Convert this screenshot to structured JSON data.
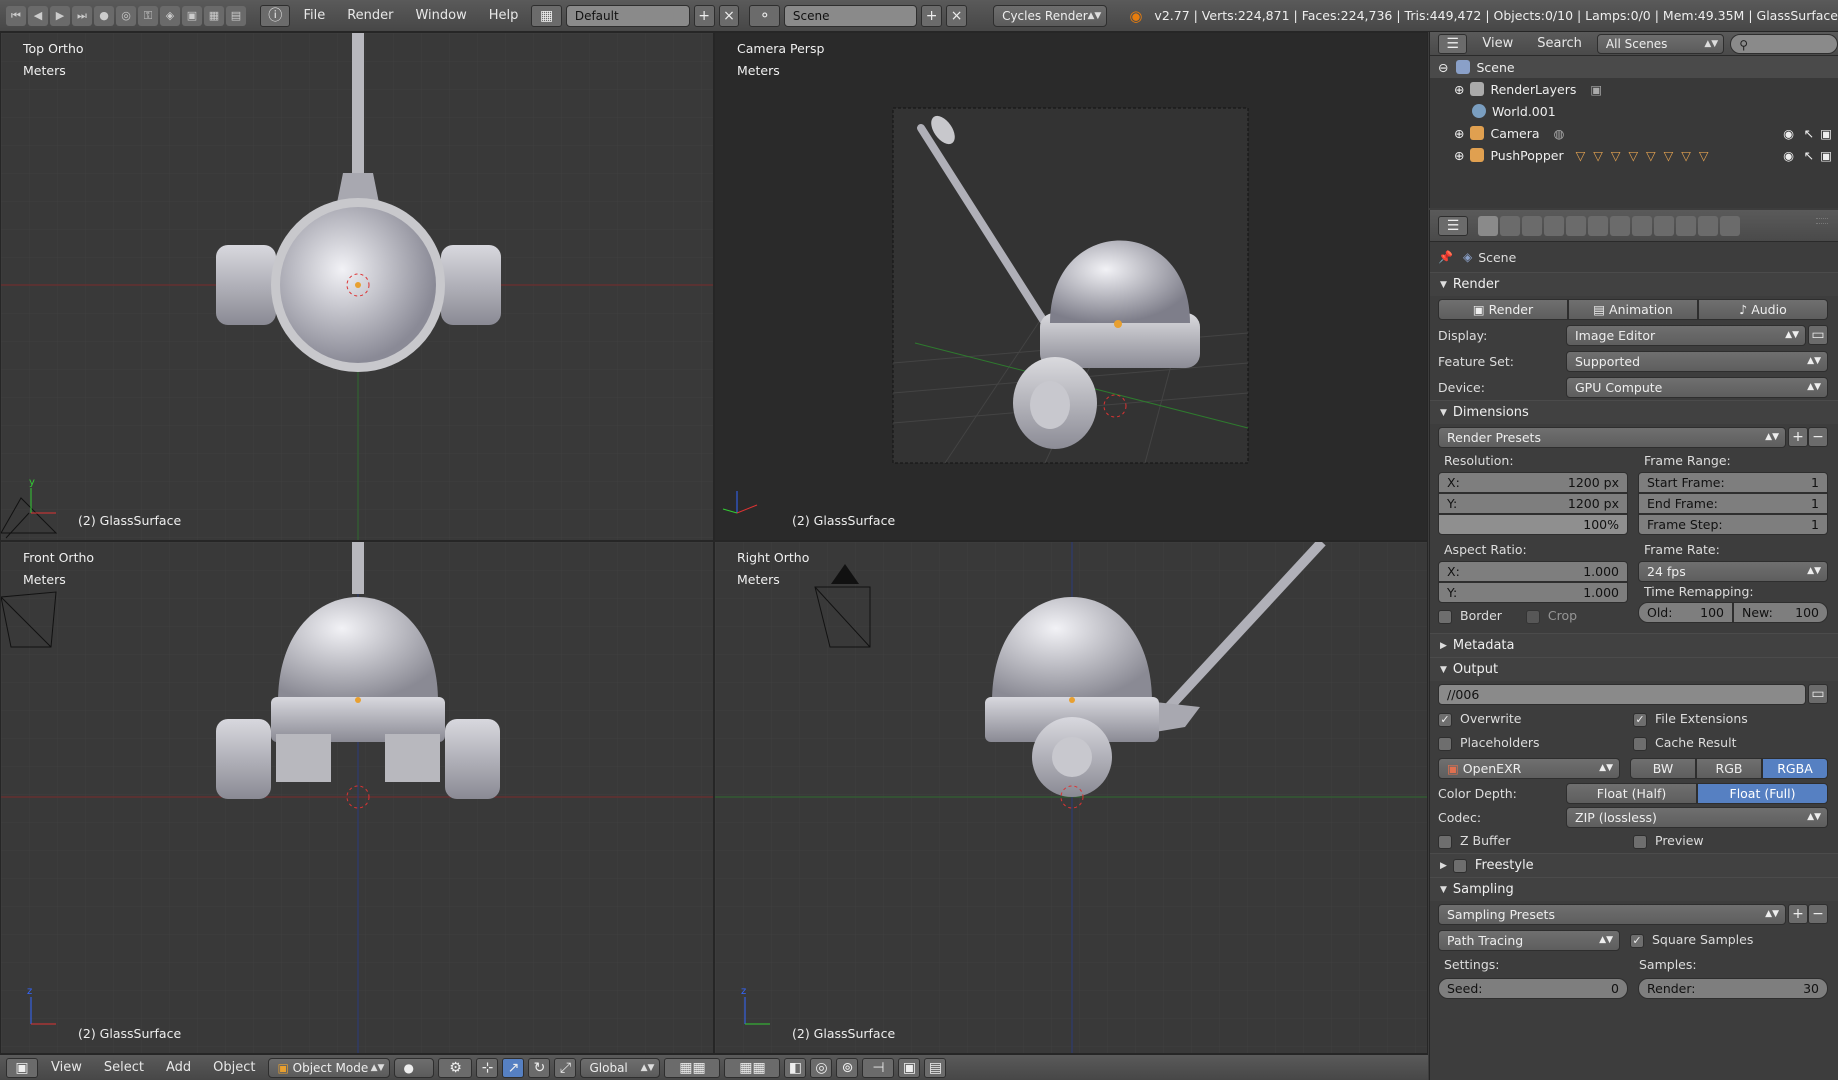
{
  "topbar": {
    "menus": [
      "File",
      "Render",
      "Window",
      "Help"
    ],
    "layout": "Default",
    "scene": "Scene",
    "engine": "Cycles Render",
    "stats": "v2.77 | Verts:224,871 | Faces:224,736 | Tris:449,472 | Objects:0/10 | Lamps:0/0 | Mem:49.35M | GlassSurface"
  },
  "viewports": {
    "top_left": {
      "view": "Top Ortho",
      "units": "Meters",
      "object": "(2) GlassSurface"
    },
    "top_right": {
      "view": "Camera Persp",
      "units": "Meters",
      "object": "(2) GlassSurface"
    },
    "bottom_left": {
      "view": "Front Ortho",
      "units": "Meters",
      "object": "(2) GlassSurface"
    },
    "bottom_right": {
      "view": "Right Ortho",
      "units": "Meters",
      "object": "(2) GlassSurface"
    }
  },
  "bottombar": {
    "menus": [
      "View",
      "Select",
      "Add",
      "Object"
    ],
    "mode": "Object Mode",
    "orientation": "Global"
  },
  "outliner": {
    "menus": [
      "View",
      "Search"
    ],
    "filter": "All Scenes",
    "items": [
      {
        "label": "Scene",
        "icon_color": "#8aa0c8",
        "indent": 0
      },
      {
        "label": "RenderLayers",
        "icon_color": "#aaaaaa",
        "indent": 1
      },
      {
        "label": "World.001",
        "icon_color": "#7a9ec0",
        "indent": 1
      },
      {
        "label": "Camera",
        "icon_color": "#e0a050",
        "indent": 1
      },
      {
        "label": "PushPopper",
        "icon_color": "#e0a050",
        "indent": 1
      }
    ]
  },
  "props": {
    "context": "Scene",
    "render": {
      "title": "Render",
      "buttons": [
        "Render",
        "Animation",
        "Audio"
      ],
      "display_label": "Display:",
      "display": "Image Editor",
      "featureset_label": "Feature Set:",
      "featureset": "Supported",
      "device_label": "Device:",
      "device": "GPU Compute"
    },
    "dimensions": {
      "title": "Dimensions",
      "presets": "Render Presets",
      "resolution_label": "Resolution:",
      "res_x_label": "X:",
      "res_x": "1200 px",
      "res_y_label": "Y:",
      "res_y": "1200 px",
      "res_pct": "100%",
      "frame_range_label": "Frame Range:",
      "start_label": "Start Frame:",
      "start": "1",
      "end_label": "End Frame:",
      "end": "1",
      "step_label": "Frame Step:",
      "step": "1",
      "aspect_label": "Aspect Ratio:",
      "asp_x_label": "X:",
      "asp_x": "1.000",
      "asp_y_label": "Y:",
      "asp_y": "1.000",
      "framerate_label": "Frame Rate:",
      "framerate": "24 fps",
      "time_remap_label": "Time Remapping:",
      "old_label": "Old:",
      "old": "100",
      "new_label": "New:",
      "new": "100",
      "border": "Border",
      "crop": "Crop"
    },
    "metadata": {
      "title": "Metadata"
    },
    "output": {
      "title": "Output",
      "path": "//006",
      "overwrite": "Overwrite",
      "file_ext": "File Extensions",
      "placeholders": "Placeholders",
      "cache": "Cache Result",
      "format": "OpenEXR",
      "channels": [
        "BW",
        "RGB",
        "RGBA"
      ],
      "depth_label": "Color Depth:",
      "depths": [
        "Float (Half)",
        "Float (Full)"
      ],
      "codec_label": "Codec:",
      "codec": "ZIP (lossless)",
      "zbuffer": "Z Buffer",
      "preview": "Preview"
    },
    "freestyle": {
      "title": "Freestyle"
    },
    "sampling": {
      "title": "Sampling",
      "presets": "Sampling Presets",
      "integrator": "Path Tracing",
      "square": "Square Samples",
      "settings_label": "Settings:",
      "samples_label": "Samples:",
      "seed_label": "Seed:",
      "seed": "0",
      "render_label": "Render:",
      "render": "30"
    }
  }
}
